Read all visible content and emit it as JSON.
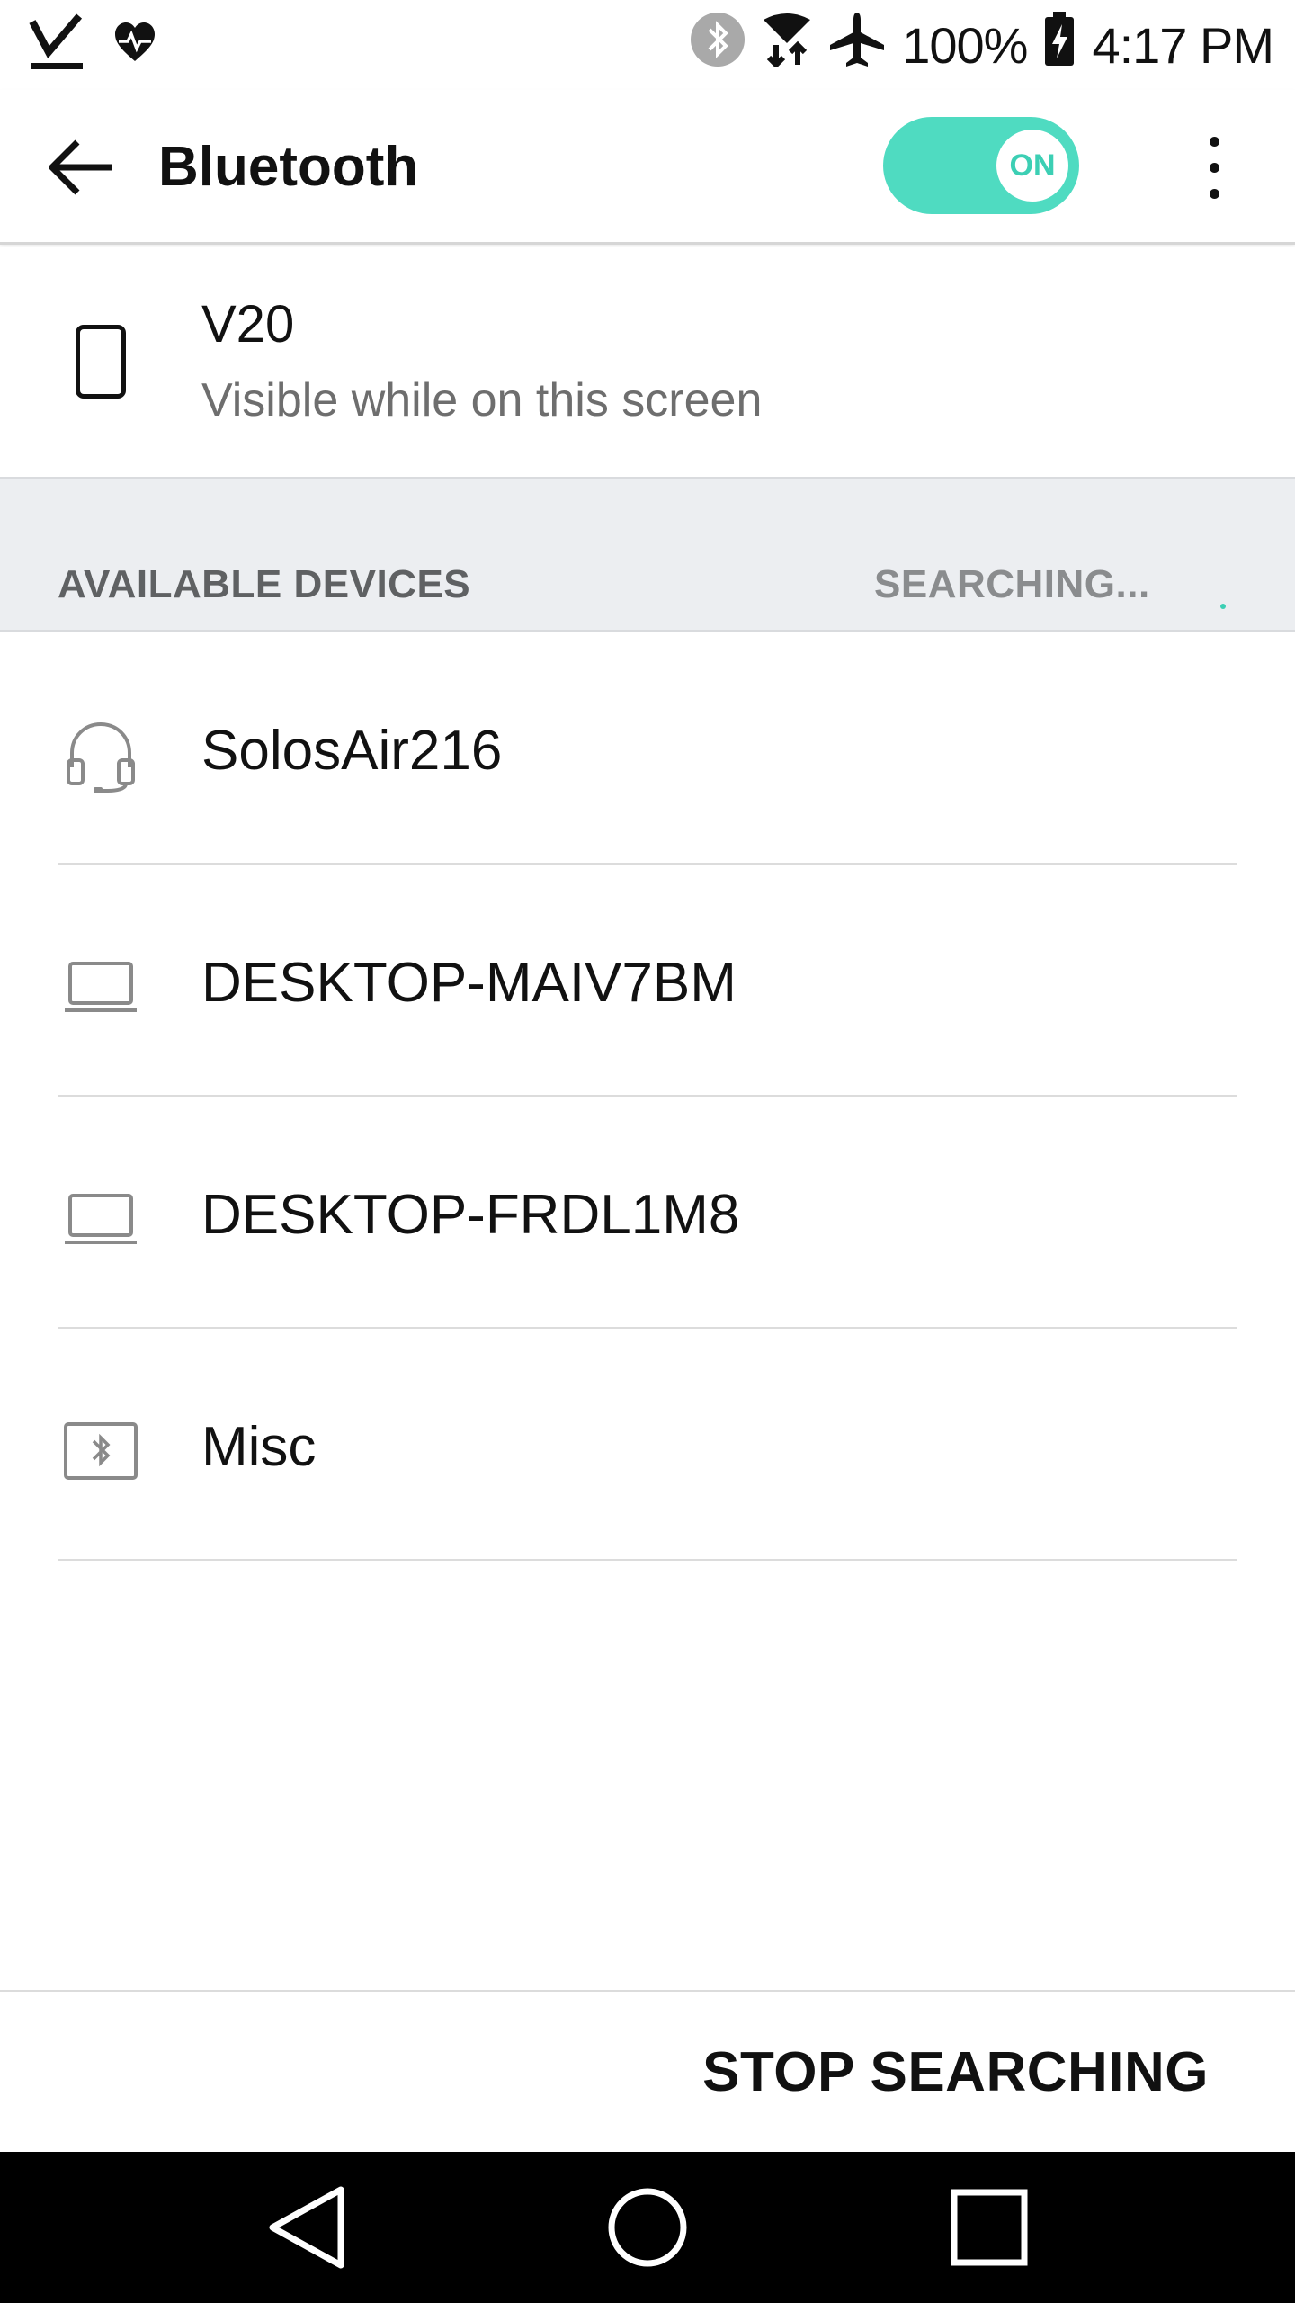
{
  "status_bar": {
    "battery": "100%",
    "time": "4:17 PM",
    "icons": [
      "download-done-icon",
      "heart-rate-icon",
      "bluetooth-icon",
      "data-transfer-icon",
      "airplane-icon",
      "battery-charging-icon"
    ]
  },
  "app_bar": {
    "title": "Bluetooth",
    "toggle_label": "ON",
    "toggle_state": true,
    "accent_color": "#4fdbc1"
  },
  "own_device": {
    "name": "V20",
    "subtitle": "Visible while on this screen",
    "icon": "phone-icon"
  },
  "section": {
    "title": "AVAILABLE DEVICES",
    "status": "SEARCHING..."
  },
  "devices": [
    {
      "name": "SolosAir216",
      "icon": "headset-icon"
    },
    {
      "name": "DESKTOP-MAIV7BM",
      "icon": "laptop-icon"
    },
    {
      "name": "DESKTOP-FRDL1M8",
      "icon": "laptop-icon"
    },
    {
      "name": "Misc",
      "icon": "bluetooth-device-icon"
    }
  ],
  "bottom": {
    "action_label": "STOP SEARCHING"
  },
  "nav": {
    "icons": [
      "nav-back-icon",
      "nav-home-icon",
      "nav-recents-icon"
    ]
  }
}
